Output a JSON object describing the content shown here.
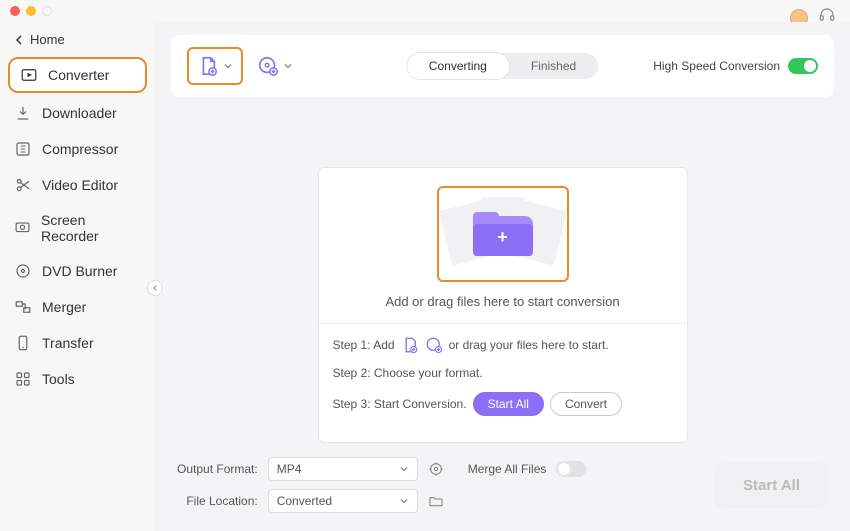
{
  "home_label": "Home",
  "sidebar": {
    "items": [
      {
        "label": "Converter"
      },
      {
        "label": "Downloader"
      },
      {
        "label": "Compressor"
      },
      {
        "label": "Video Editor"
      },
      {
        "label": "Screen Recorder"
      },
      {
        "label": "DVD Burner"
      },
      {
        "label": "Merger"
      },
      {
        "label": "Transfer"
      },
      {
        "label": "Tools"
      }
    ]
  },
  "tabs": {
    "converting": "Converting",
    "finished": "Finished"
  },
  "hsc_label": "High Speed Conversion",
  "drop_text": "Add or drag files here to start conversion",
  "steps": {
    "s1a": "Step 1: Add",
    "s1b": "or drag your files here to start.",
    "s2": "Step 2: Choose your format.",
    "s3": "Step 3: Start Conversion.",
    "startall_pill": "Start  All",
    "convert_pill": "Convert"
  },
  "footer": {
    "out_label": "Output Format:",
    "out_value": "MP4",
    "loc_label": "File Location:",
    "loc_value": "Converted",
    "merge_label": "Merge All Files",
    "startall": "Start All"
  },
  "colors": {
    "accent": "#8b6ff5",
    "highlight": "#e88a2a",
    "toggle_on": "#34c759"
  }
}
